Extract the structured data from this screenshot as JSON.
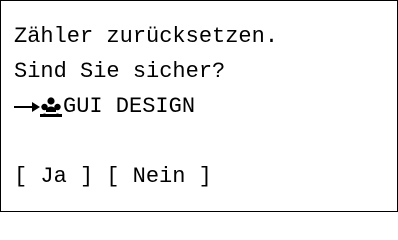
{
  "message": {
    "line1": "Zähler zurücksetzen.",
    "line2": "Sind Sie sicher?"
  },
  "target": {
    "arrow_icon": "right-arrow-icon",
    "group_icon": "user-group-icon",
    "name": "GUI DESIGN"
  },
  "softkeys": {
    "yes_label": "[ Ja ]",
    "no_label": "[ Nein ]"
  },
  "colors": {
    "foreground": "#000000",
    "background": "#ffffff"
  }
}
